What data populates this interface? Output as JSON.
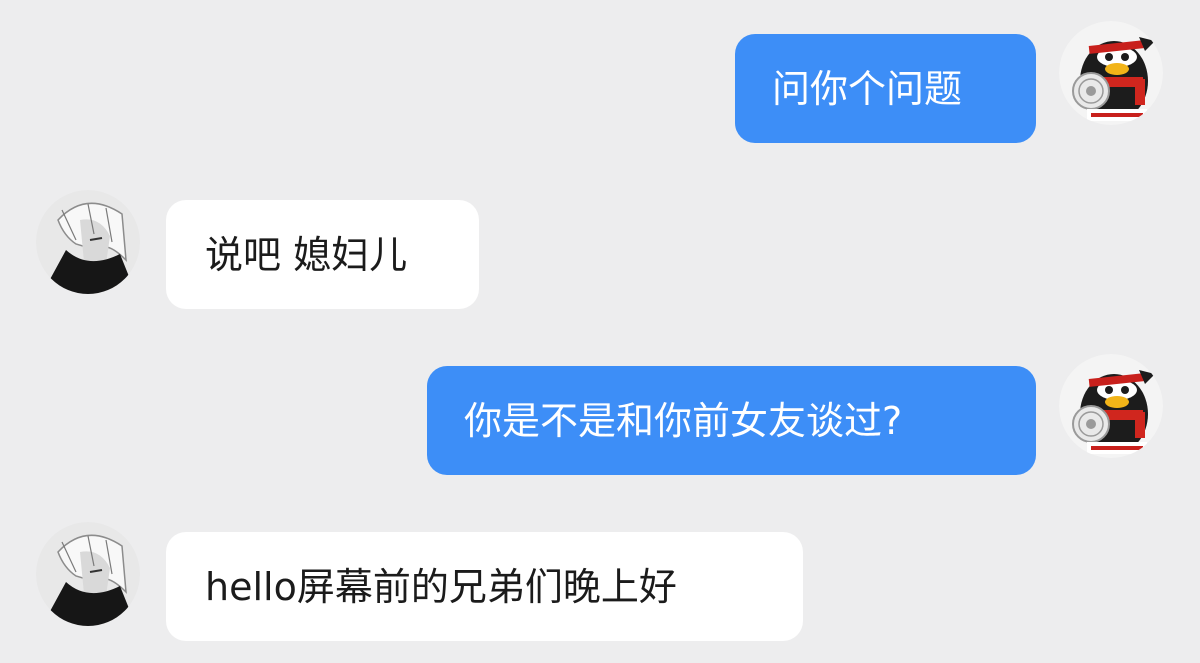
{
  "chat": {
    "messages": [
      {
        "direction": "outgoing",
        "text": "问你个问题",
        "avatar": "qq-penguin-avatar"
      },
      {
        "direction": "incoming",
        "text": "说吧 媳妇儿",
        "avatar": "anime-character-avatar"
      },
      {
        "direction": "outgoing",
        "text": "你是不是和你前女友谈过?",
        "avatar": "qq-penguin-avatar"
      },
      {
        "direction": "incoming",
        "text": "hello屏幕前的兄弟们晚上好",
        "avatar": "anime-character-avatar"
      }
    ]
  },
  "colors": {
    "background": "#ededee",
    "outgoing_bubble": "#3d8ef7",
    "incoming_bubble": "#ffffff"
  }
}
